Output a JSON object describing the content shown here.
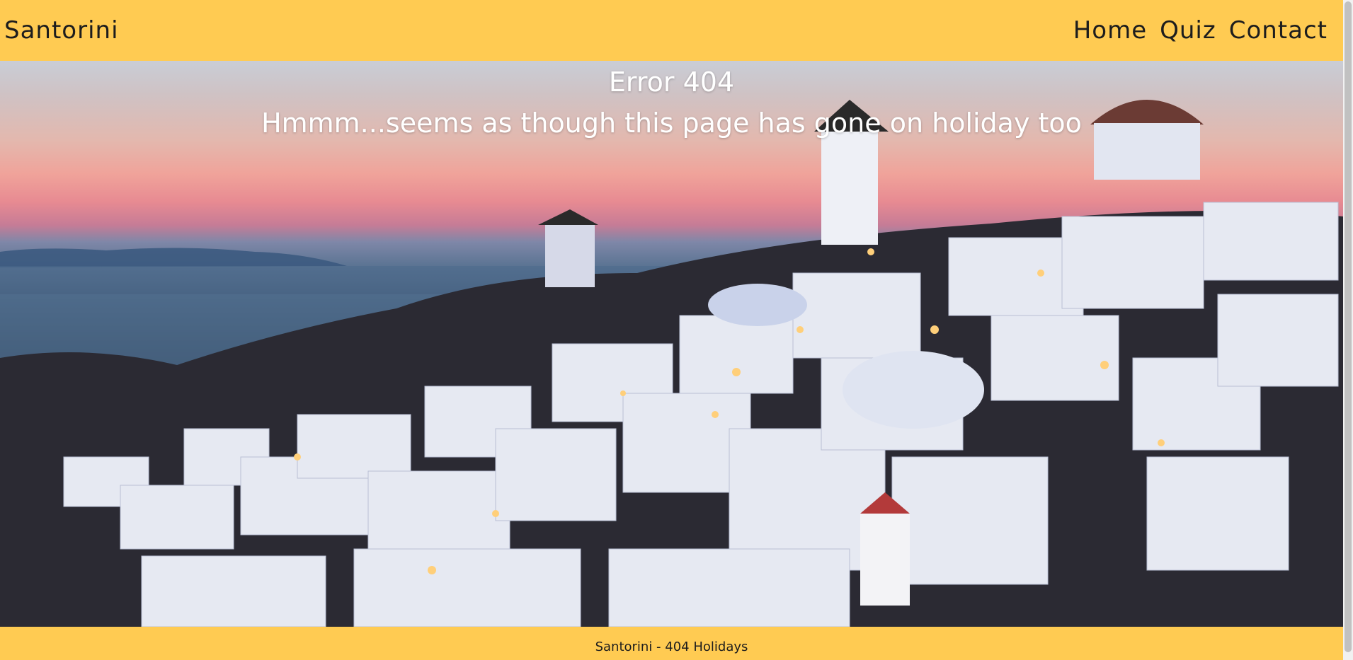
{
  "header": {
    "brand": "Santorini",
    "nav": [
      {
        "label": "Home"
      },
      {
        "label": "Quiz"
      },
      {
        "label": "Contact"
      }
    ]
  },
  "hero": {
    "title": "Error 404",
    "subtitle": "Hmmm...seems as though this page has gone on holiday too",
    "background_image": "santorini-sunset-photo"
  },
  "footer": {
    "text": "Santorini - 404 Holidays"
  },
  "colors": {
    "header_bg": "#ffcb52",
    "footer_bg": "#ffcb52",
    "text_dark": "#1d1d1d",
    "hero_text": "#ffffff"
  }
}
